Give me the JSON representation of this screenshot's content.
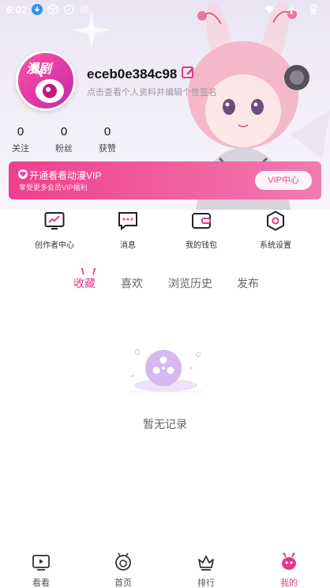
{
  "status_bar": {
    "time": "6:02"
  },
  "profile": {
    "avatar_text": "漫剧",
    "username": "eceb0e384c98",
    "hint": "点击查看个人资料并编辑个性签名"
  },
  "stats": [
    {
      "value": "0",
      "label": "关注"
    },
    {
      "value": "0",
      "label": "粉丝"
    },
    {
      "value": "0",
      "label": "获赞"
    }
  ],
  "vip": {
    "title": "开通看看动漫VIP",
    "subtitle": "享受更多会员VIP福利",
    "button": "VIP中心"
  },
  "menu": [
    {
      "label": "创作者中心",
      "icon": "chart-screen-icon"
    },
    {
      "label": "消息",
      "icon": "message-icon"
    },
    {
      "label": "我的钱包",
      "icon": "wallet-icon"
    },
    {
      "label": "系统设置",
      "icon": "settings-hex-icon"
    }
  ],
  "tabs": [
    {
      "label": "收藏",
      "active": true
    },
    {
      "label": "喜欢"
    },
    {
      "label": "浏览历史"
    },
    {
      "label": "发布"
    }
  ],
  "empty": {
    "text": "暂无记录"
  },
  "bottom_nav": [
    {
      "label": "看看",
      "icon": "video-icon"
    },
    {
      "label": "首页",
      "icon": "home-face-icon"
    },
    {
      "label": "排行",
      "icon": "crown-icon"
    },
    {
      "label": "我的",
      "icon": "profile-bug-icon",
      "active": true
    }
  ],
  "colors": {
    "accent": "#e23a8a",
    "vip_gradient_start": "#ee3f8d",
    "vip_gradient_end": "#f27bb1"
  }
}
